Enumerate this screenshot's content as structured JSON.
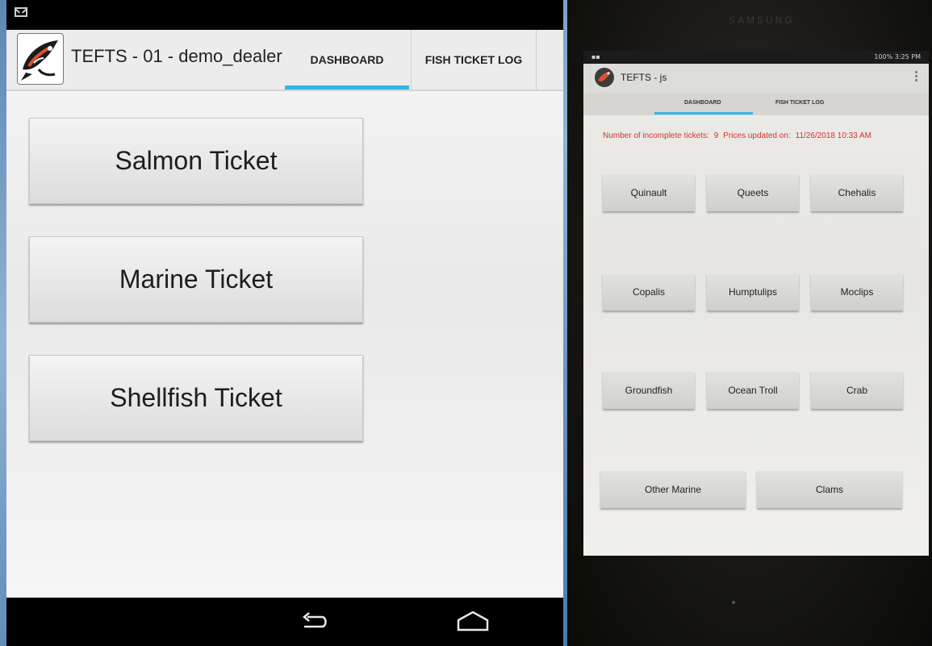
{
  "left_app": {
    "title": "TEFTS - 01 - demo_dealer",
    "tabs": [
      {
        "label": "DASHBOARD",
        "selected": true
      },
      {
        "label": "FISH TICKET LOG",
        "selected": false
      }
    ],
    "buttons": [
      {
        "label": "Salmon Ticket"
      },
      {
        "label": "Marine Ticket"
      },
      {
        "label": "Shellfish Ticket"
      }
    ],
    "status_icons": [
      "gmail-icon"
    ],
    "nav_icons": [
      "back-icon",
      "home-icon"
    ],
    "accent_color": "#33b5e5"
  },
  "tablet_app": {
    "brand": "SAMSUNG",
    "status_right": "100% 3:25 PM",
    "title": "TEFTS - js",
    "tabs": [
      {
        "label": "DASHBOARD",
        "selected": true
      },
      {
        "label": "FISH TICKET LOG",
        "selected": false
      }
    ],
    "incomplete_label": "Number of incomplete tickets:",
    "incomplete_count": "9",
    "prices_label": "Prices updated on:",
    "prices_date": "11/26/2018 10:33 AM",
    "buttons": [
      {
        "label": "Quinault"
      },
      {
        "label": "Queets"
      },
      {
        "label": "Chehalis"
      },
      {
        "label": "Copalis"
      },
      {
        "label": "Humptulips"
      },
      {
        "label": "Moclips"
      },
      {
        "label": "Groundfish"
      },
      {
        "label": "Ocean Troll"
      },
      {
        "label": "Crab"
      },
      {
        "label": "Other Marine"
      },
      {
        "label": "Clams"
      }
    ],
    "info_color": "#d93030"
  }
}
